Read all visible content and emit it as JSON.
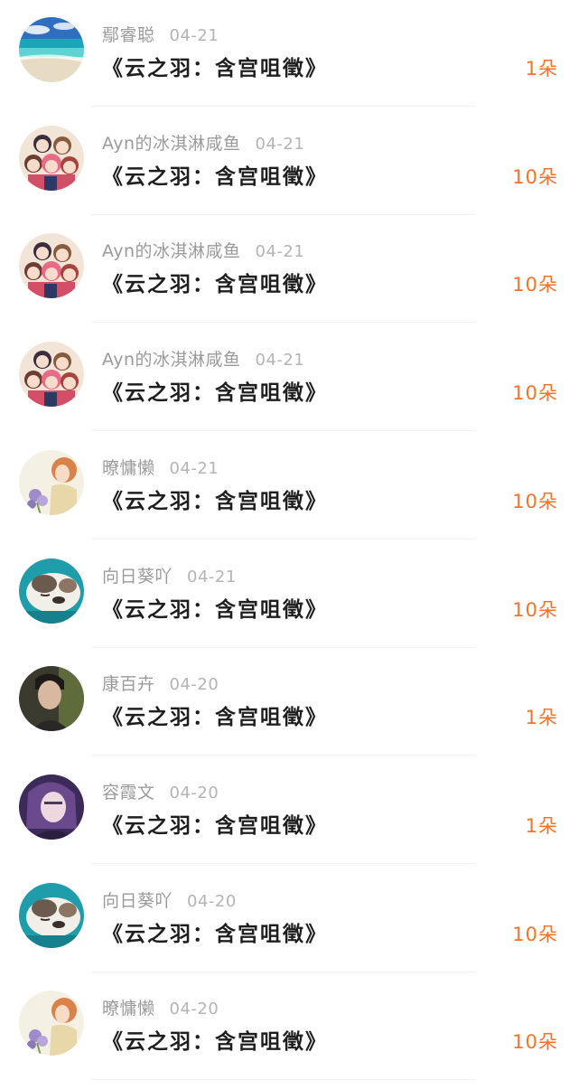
{
  "rows": [
    {
      "name": "鄢睿聪",
      "date": "04-21",
      "title": "《云之羽：含宫咀徵》",
      "amount": "1朵",
      "avatar": "beach-scene"
    },
    {
      "name": "Ayn的冰淇淋咸鱼",
      "date": "04-21",
      "title": "《云之羽：含宫咀徵》",
      "amount": "10朵",
      "avatar": "anime-girls-group"
    },
    {
      "name": "Ayn的冰淇淋咸鱼",
      "date": "04-21",
      "title": "《云之羽：含宫咀徵》",
      "amount": "10朵",
      "avatar": "anime-girls-group"
    },
    {
      "name": "Ayn的冰淇淋咸鱼",
      "date": "04-21",
      "title": "《云之羽：含宫咀徵》",
      "amount": "10朵",
      "avatar": "anime-girls-group"
    },
    {
      "name": "暸慵懒",
      "date": "04-21",
      "title": "《云之羽：含宫咀徵》",
      "amount": "10朵",
      "avatar": "painted-girl-flowers"
    },
    {
      "name": "向日葵吖",
      "date": "04-21",
      "title": "《云之羽：含宫咀徵》",
      "amount": "10朵",
      "avatar": "sleeping-dog"
    },
    {
      "name": "康百卉",
      "date": "04-20",
      "title": "《云之羽：含宫咀徵》",
      "amount": "1朵",
      "avatar": "man-portrait"
    },
    {
      "name": "容霞文",
      "date": "04-20",
      "title": "《云之羽：含宫咀徵》",
      "amount": "1朵",
      "avatar": "purple-portrait"
    },
    {
      "name": "向日葵吖",
      "date": "04-20",
      "title": "《云之羽：含宫咀徵》",
      "amount": "10朵",
      "avatar": "sleeping-dog"
    },
    {
      "name": "暸慵懒",
      "date": "04-20",
      "title": "《云之羽：含宫咀徵》",
      "amount": "10朵",
      "avatar": "painted-girl-flowers"
    }
  ],
  "colors": {
    "amount": "#f5732a",
    "name": "#9a9a9a",
    "title": "#1e1e1e"
  }
}
